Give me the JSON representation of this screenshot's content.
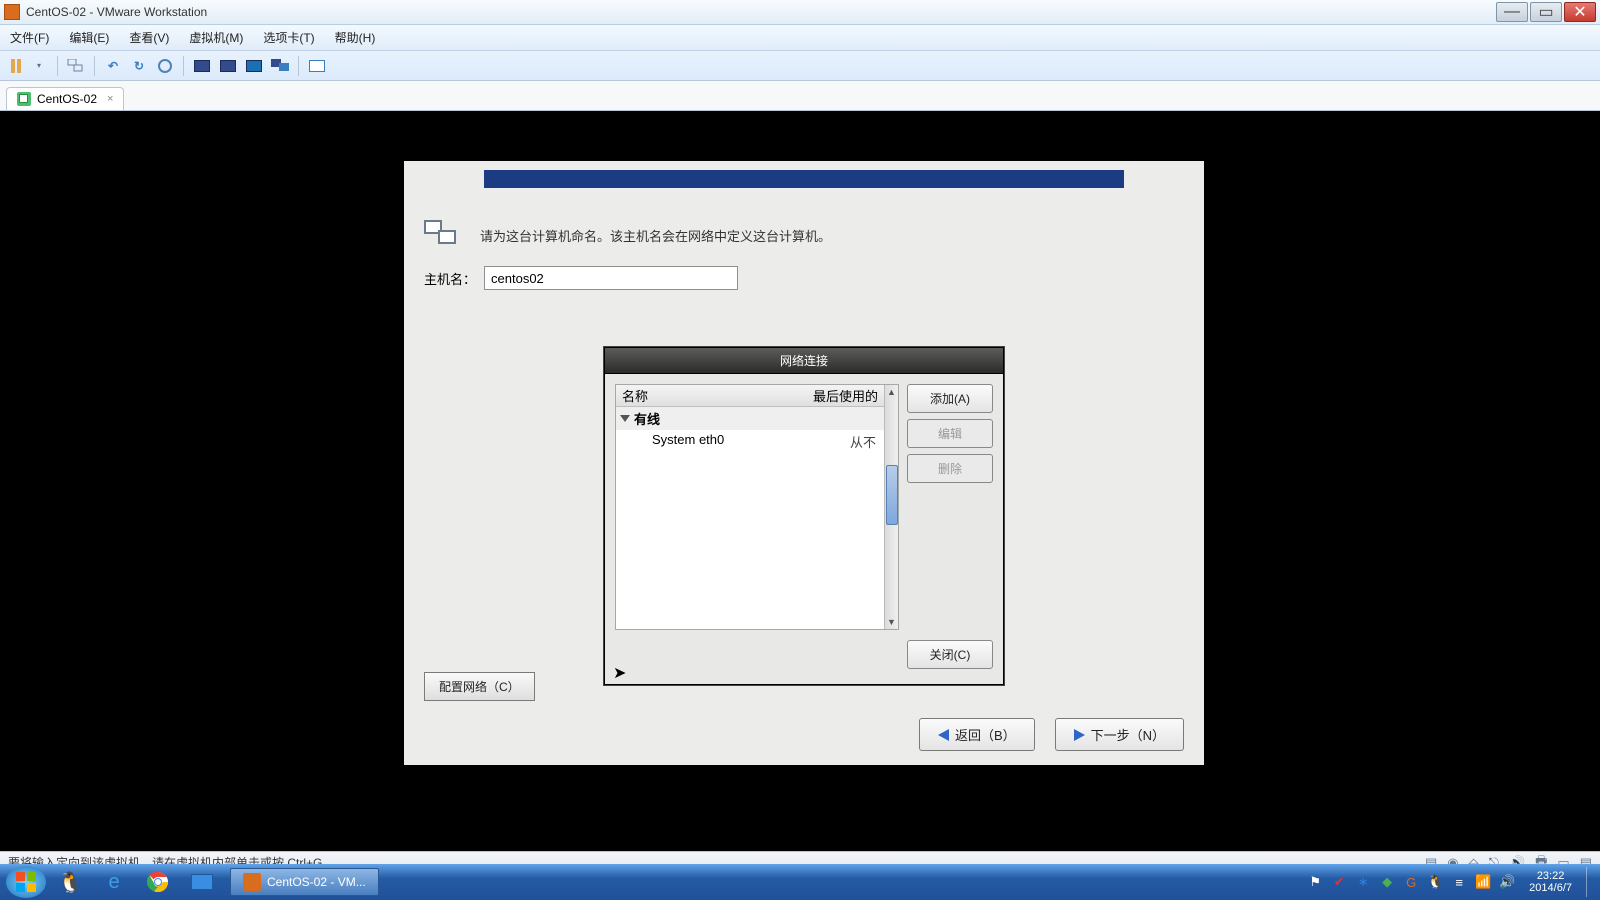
{
  "window": {
    "title": "CentOS-02 - VMware Workstation"
  },
  "menu": {
    "file": "文件(F)",
    "edit": "编辑(E)",
    "view": "查看(V)",
    "vm": "虚拟机(M)",
    "tabs": "选项卡(T)",
    "help": "帮助(H)"
  },
  "tab": {
    "name": "CentOS-02"
  },
  "installer": {
    "instruction": "请为这台计算机命名。该主机名会在网络中定义这台计算机。",
    "hostname_label": "主机名：",
    "hostname_value": "centos02",
    "config_network_btn": "配置网络（C）",
    "back_btn": "返回（B）",
    "next_btn": "下一步（N）"
  },
  "dialog": {
    "title": "网络连接",
    "col_name": "名称",
    "col_lastused": "最后使用的",
    "group_wired": "有线",
    "item_name": "System eth0",
    "item_lastused": "从不",
    "add_btn": "添加(A)",
    "edit_btn": "编辑",
    "delete_btn": "删除",
    "close_btn": "关闭(C)"
  },
  "statusbar": {
    "hint": "要将输入定向到该虚拟机，请在虚拟机内部单击或按 Ctrl+G。"
  },
  "taskbar": {
    "active_task": "CentOS-02 - VM..."
  },
  "clock": {
    "time": "23:22",
    "date": "2014/6/7"
  },
  "icons": {
    "pause": "pause-icon",
    "snapshot": "snapshot-icon",
    "refresh": "refresh-icon",
    "clock": "clock-icon",
    "screens": "screen-icon",
    "fullscreen": "fullscreen-icon"
  }
}
